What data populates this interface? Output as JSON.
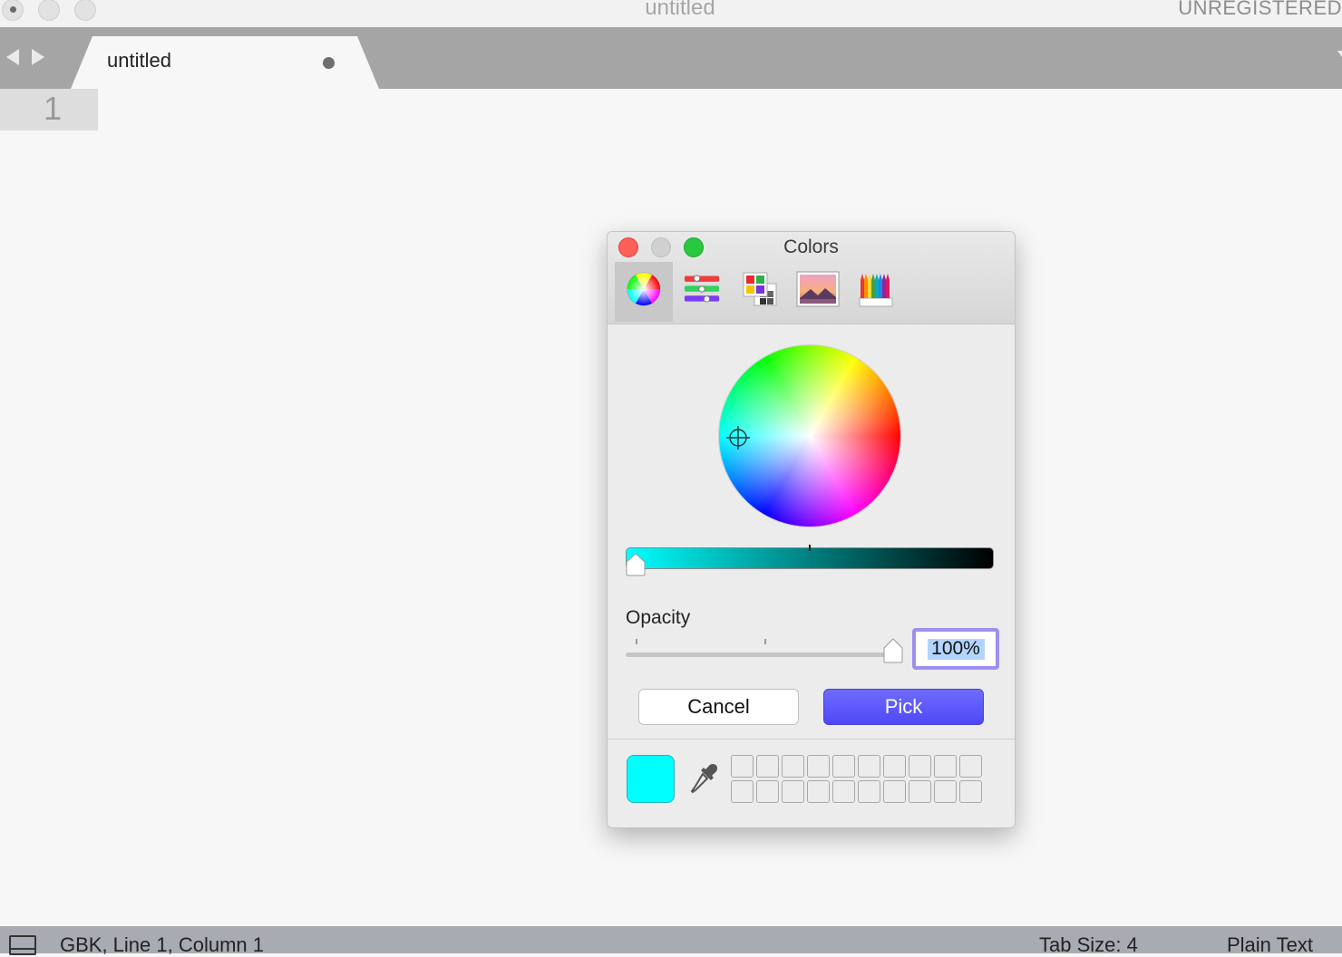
{
  "window": {
    "title": "untitled",
    "license_status": "UNREGISTERED"
  },
  "tabs": [
    {
      "label": "untitled",
      "modified": true
    }
  ],
  "editor": {
    "line_numbers": [
      "1"
    ]
  },
  "statusbar": {
    "position": "GBK, Line 1, Column 1",
    "tab_size": "Tab Size: 4",
    "syntax": "Plain Text"
  },
  "color_panel": {
    "title": "Colors",
    "modes": [
      {
        "name": "color-wheel-icon",
        "active": true
      },
      {
        "name": "color-sliders-icon",
        "active": false
      },
      {
        "name": "color-palettes-icon",
        "active": false
      },
      {
        "name": "image-palettes-icon",
        "active": false
      },
      {
        "name": "pencils-icon",
        "active": false
      }
    ],
    "selected_color": "#00ffff",
    "brightness_level": 1.0,
    "opacity_label": "Opacity",
    "opacity_value": "100%",
    "opacity_level": 1.0,
    "cancel_label": "Cancel",
    "pick_label": "Pick",
    "accent_color": "#5a55f8",
    "custom_swatch_slots": 20
  }
}
